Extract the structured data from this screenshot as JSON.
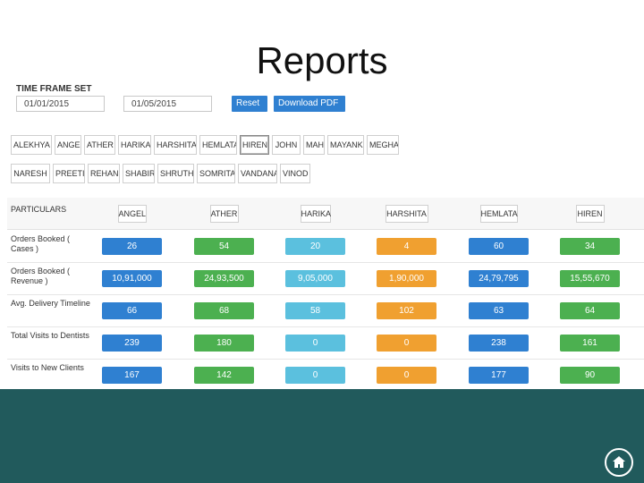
{
  "page": {
    "title": "Reports"
  },
  "time_frame": {
    "label": "TIME FRAME SET",
    "from_date": "01/01/2015",
    "to_date": "01/05/2015",
    "reset_label": "Reset >",
    "download_label": "Download PDF >"
  },
  "employees_row1": [
    "ALEKHYA",
    "ANGEL",
    "ATHER",
    "HARIKA",
    "HARSHITA",
    "HEMLATA",
    "HIREN",
    "JOHN",
    "MAHI",
    "MAYANK",
    "MEGHA"
  ],
  "employees_row2": [
    "NARESH",
    "PREETI",
    "REHAN",
    "SHABIR",
    "SHRUTHI",
    "SOMRITA",
    "VANDANA",
    "VINOD"
  ],
  "selected_employee": "HIREN",
  "table": {
    "particulars_label": "PARTICULARS",
    "columns": [
      "ANGEL",
      "ATHER",
      "HARIKA",
      "HARSHITA",
      "HEMLATA",
      "HIREN"
    ],
    "rows": [
      {
        "label": "Orders Booked ( Cases )",
        "values": [
          "26",
          "54",
          "20",
          "4",
          "60",
          "34"
        ]
      },
      {
        "label": "Orders Booked ( Revenue )",
        "values": [
          "10,91,000",
          "24,93,500",
          "9,05,000",
          "1,90,000",
          "24,79,795",
          "15,55,670"
        ]
      },
      {
        "label": "Avg. Delivery Timeline",
        "values": [
          "66",
          "68",
          "58",
          "102",
          "63",
          "64"
        ]
      },
      {
        "label": "Total Visits to Dentists",
        "values": [
          "239",
          "180",
          "0",
          "0",
          "238",
          "161"
        ]
      },
      {
        "label": "Visits to New Clients",
        "values": [
          "167",
          "142",
          "0",
          "0",
          "177",
          "90"
        ]
      }
    ]
  },
  "colors": {
    "blue": "#2f80d1",
    "green": "#4cb050",
    "cyan": "#5bc0de",
    "orange": "#f0a030",
    "footer": "#215a5c"
  },
  "icons": {
    "home": "home-icon"
  }
}
